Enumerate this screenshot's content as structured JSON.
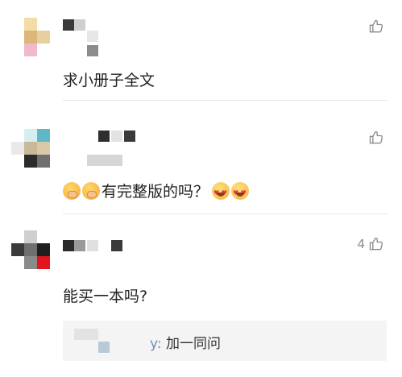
{
  "comments": [
    {
      "text": "求小册子全文",
      "avatar_colors": [
        "#f3dda4",
        "#ddb779",
        "#e7cfa1",
        "#f2b9c9"
      ],
      "like_count": ""
    },
    {
      "text": "有完整版的吗？",
      "emoji_before": [
        "shushing-face-emoji",
        "shushing-face-emoji"
      ],
      "emoji_after": [
        "heart-eyes-emoji",
        "heart-eyes-emoji"
      ],
      "avatar_colors": [
        "#d7eef0",
        "#5fb7c8",
        "#c9b99b",
        "#d9c9a6",
        "#2b2b2b",
        "#6f6f6f"
      ],
      "like_count": ""
    },
    {
      "text": "能买一本吗?",
      "avatar_colors": [
        "#cfcfcf",
        "#6f6f6f",
        "#1f1f1f",
        "#8a8a8a",
        "#e3141b"
      ],
      "like_count": "4",
      "reply": {
        "name": "y",
        "separator": ":",
        "text": "加一同问"
      }
    }
  ],
  "icons": {
    "like": "thumbs-up-icon"
  },
  "colors": {
    "text": "#222222",
    "muted": "#8a8a8a",
    "divider": "#e6e6e6",
    "reply_bg": "#f4f4f4",
    "reply_name": "#6f8fb0"
  }
}
